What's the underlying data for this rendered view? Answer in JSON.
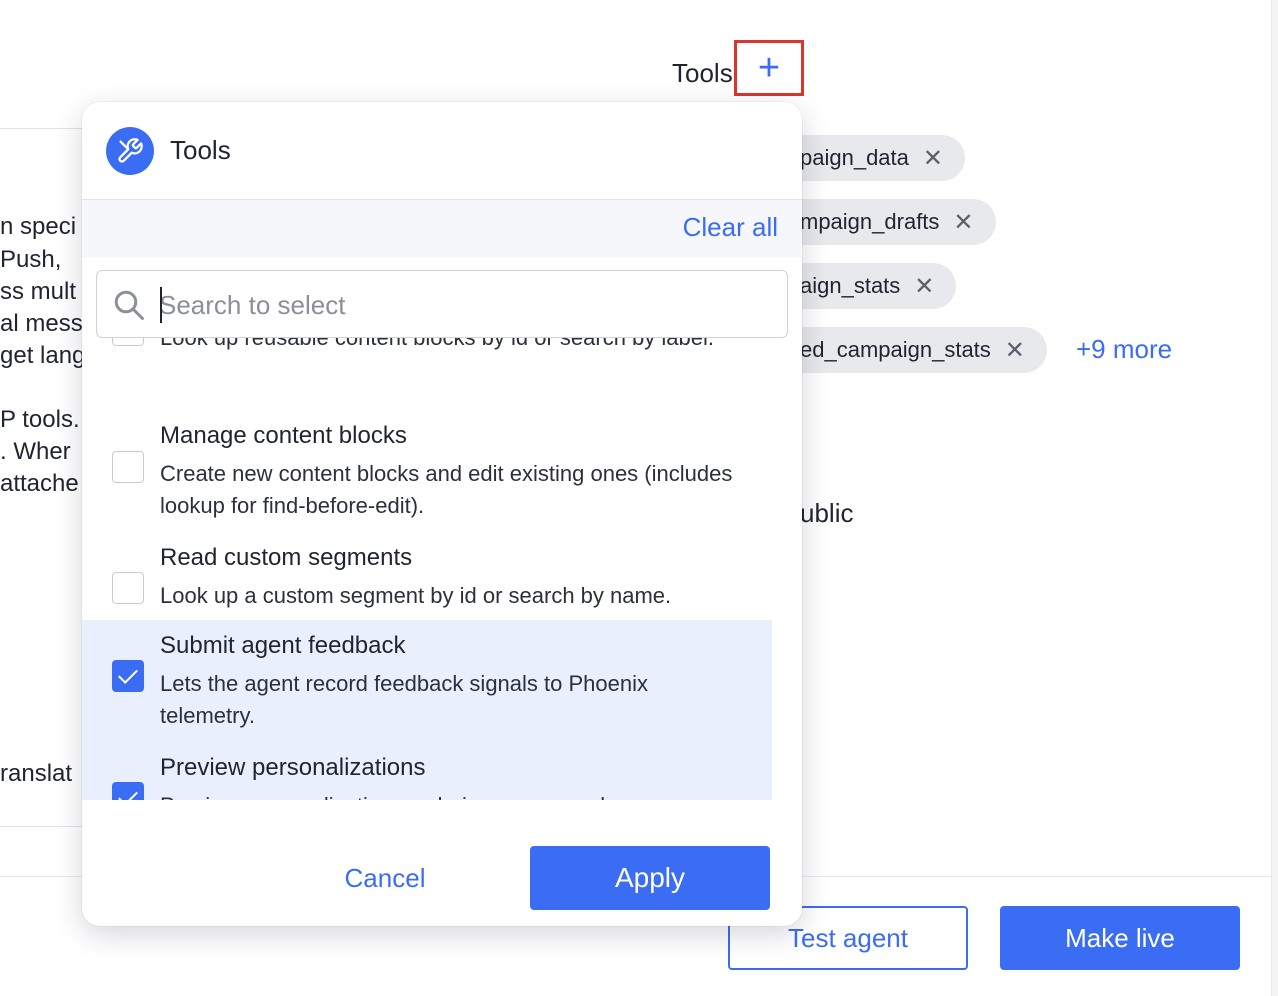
{
  "background": {
    "left_text_lines": [
      "n speci",
      " Push,",
      "ss mult",
      "al mess",
      "get lang",
      "P tools.",
      ". Wher",
      "attache",
      "ranslat"
    ],
    "tools_label": "Tools",
    "chips": [
      {
        "label": "paign_data"
      },
      {
        "label": "mpaign_drafts"
      },
      {
        "label": "aign_stats"
      },
      {
        "label": "ed_campaign_stats"
      }
    ],
    "chip_remove_glyph": "✕",
    "more_label": "+9 more",
    "public_label": "ublic",
    "test_agent_label": "Test agent",
    "make_live_label": "Make live"
  },
  "popover": {
    "title": "Tools",
    "clear_all_label": "Clear all",
    "search": {
      "placeholder": "Search to select",
      "value": ""
    },
    "items": [
      {
        "title": "",
        "description": "Look up reusable content blocks by id or search by label.",
        "checked": false
      },
      {
        "title": "Manage content blocks",
        "description": "Create new content blocks and edit existing ones (includes lookup for find-before-edit).",
        "checked": false
      },
      {
        "title": "Read custom segments",
        "description": "Look up a custom segment by id or search by name.",
        "checked": false
      },
      {
        "title": "Submit agent feedback",
        "description": "Lets the agent record feedback signals to Phoenix telemetry.",
        "checked": true
      },
      {
        "title": "Preview personalizations",
        "description": "Preview personalization rendering on a sample message.",
        "checked": true
      }
    ],
    "cancel_label": "Cancel",
    "apply_label": "Apply"
  },
  "colors": {
    "accent": "#3b6cf4",
    "highlight_box": "#d9372b",
    "selected_row": "#e9effd",
    "chip_bg": "#e8e9ec"
  },
  "icons": {
    "add": "plus-icon",
    "popover": "tools-icon",
    "search": "search-icon",
    "remove": "close-icon"
  }
}
